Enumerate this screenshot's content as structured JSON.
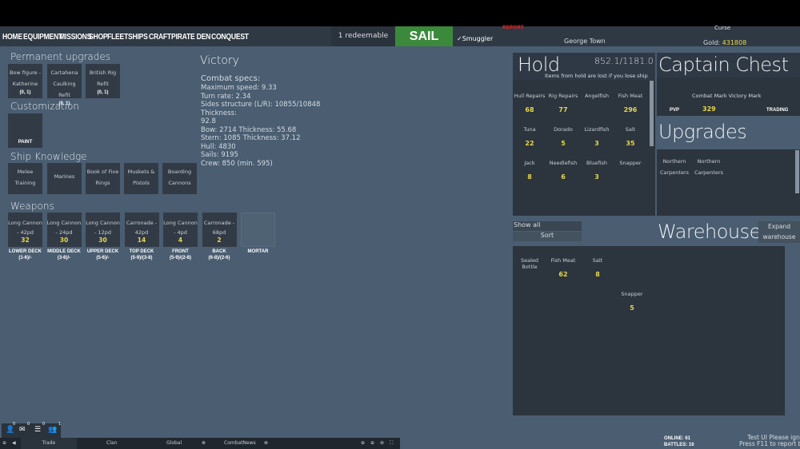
{
  "nav": {
    "items": [
      "HOME",
      "EQUIPMENT",
      "MISSIONS",
      "SHOP",
      "FLEET",
      "SHIPS",
      "CRAFT",
      "PIRATE DEN",
      "CONQUEST"
    ]
  },
  "header": {
    "redeemable": "1 redeemable",
    "sail": "SAIL",
    "smuggler": "Smuggler",
    "smuggler_checked": true,
    "report": "REPORT",
    "port": "George Town",
    "curse": "Curse",
    "gold_label": "Gold:",
    "gold_value": "431808"
  },
  "left": {
    "permanent_title": "Permanent upgrades",
    "permanent": [
      {
        "name": "Bow figure - Katherine",
        "count": "(0, 1)"
      },
      {
        "name": "Cartahena Caulking Refit",
        "count": "(0, 1)"
      },
      {
        "name": "British Rig Refit",
        "count": "(0, 1)"
      }
    ],
    "customization_title": "Customization",
    "paint": "PAINT",
    "knowledge_title": "Ship Knowledge",
    "knowledge": [
      "Melee Training",
      "Marines",
      "Book of Five Rings",
      "Muskets & Pistols",
      "Boarding Cannons"
    ],
    "weapons_title": "Weapons",
    "weapons": [
      {
        "name": "Long Cannon - 42pd",
        "count": "32",
        "slot": "LOWER DECK",
        "range": "(1-6)/-"
      },
      {
        "name": "Long Cannon - 24pd",
        "count": "30",
        "slot": "MIDDLE DECK",
        "range": "(3-6)/-"
      },
      {
        "name": "Long Cannon - 12pd",
        "count": "30",
        "slot": "UPPER DECK",
        "range": "(5-6)/-"
      },
      {
        "name": "Carronade - 42pd",
        "count": "14",
        "slot": "TOP DECK",
        "range": "(5-9)/(3-8)"
      },
      {
        "name": "Long Cannon - 4pd",
        "count": "4",
        "slot": "FRONT",
        "range": "(5-9)/(2-8)"
      },
      {
        "name": "Carronade - 68pd",
        "count": "2",
        "slot": "BACK",
        "range": "(6-8)/(2-6)"
      },
      {
        "name": "",
        "count": "",
        "slot": "MORTAR",
        "range": ""
      }
    ]
  },
  "ship": {
    "name": "Victory",
    "specs_title": "Combat specs:",
    "specs": [
      "Maximum speed: 9.33",
      "Turn rate: 2.34",
      "Sides structure (L/R): 10855/10848 Thickness:",
      "92.8",
      "Bow: 2714 Thickness: 55.68",
      "Stern: 1085 Thickness: 37.12",
      "Hull: 4830",
      "Sails: 9195",
      "Crew: 850 (min. 595)"
    ]
  },
  "hold": {
    "title": "Hold",
    "capacity": "852.1/1181.0",
    "note": "Items from hold are lost if you lose ship",
    "items": [
      {
        "name": "Hull Repairs",
        "qty": "68"
      },
      {
        "name": "Rig Repairs",
        "qty": "77"
      },
      {
        "name": "Angelfish",
        "qty": ""
      },
      {
        "name": "Fish Meat",
        "qty": "296"
      },
      {
        "name": "Tuna",
        "qty": "22"
      },
      {
        "name": "Dorado",
        "qty": "5"
      },
      {
        "name": "Lizardfish",
        "qty": "3"
      },
      {
        "name": "Salt",
        "qty": "35"
      },
      {
        "name": "Jack",
        "qty": "8"
      },
      {
        "name": "Needlefish",
        "qty": "6"
      },
      {
        "name": "Bluefish",
        "qty": "3"
      },
      {
        "name": "Snapper",
        "qty": ""
      }
    ]
  },
  "chest": {
    "title": "Captain Chest",
    "marks": "Combat Mark Victory Mark",
    "pvp": "PVP",
    "pvp_value": "329",
    "trading": "TRADING"
  },
  "upgrades": {
    "title": "Upgrades",
    "items": [
      "Northern Carpenters",
      "Northern Carpenters"
    ]
  },
  "warehouse": {
    "title": "Warehouse",
    "show_all": "Show all",
    "sort": "Sort",
    "expand": "Expand warehouse",
    "items": [
      {
        "name": "Sealed Bottle",
        "qty": ""
      },
      {
        "name": "Fish Meat",
        "qty": "62"
      },
      {
        "name": "Salt",
        "qty": "8"
      },
      {
        "name": "Snapper",
        "qty": "5"
      }
    ]
  },
  "social": {
    "badges": [
      "0",
      "0",
      "0",
      "1"
    ]
  },
  "chat": {
    "tabs": [
      "Trade",
      "Clan",
      "Global",
      "CombatNews"
    ]
  },
  "footer": {
    "online": "ONLINE: 61",
    "battles": "BATTLES: 16",
    "test1": "Test UI Please ignore",
    "test2": "Press F11 to report bug"
  }
}
